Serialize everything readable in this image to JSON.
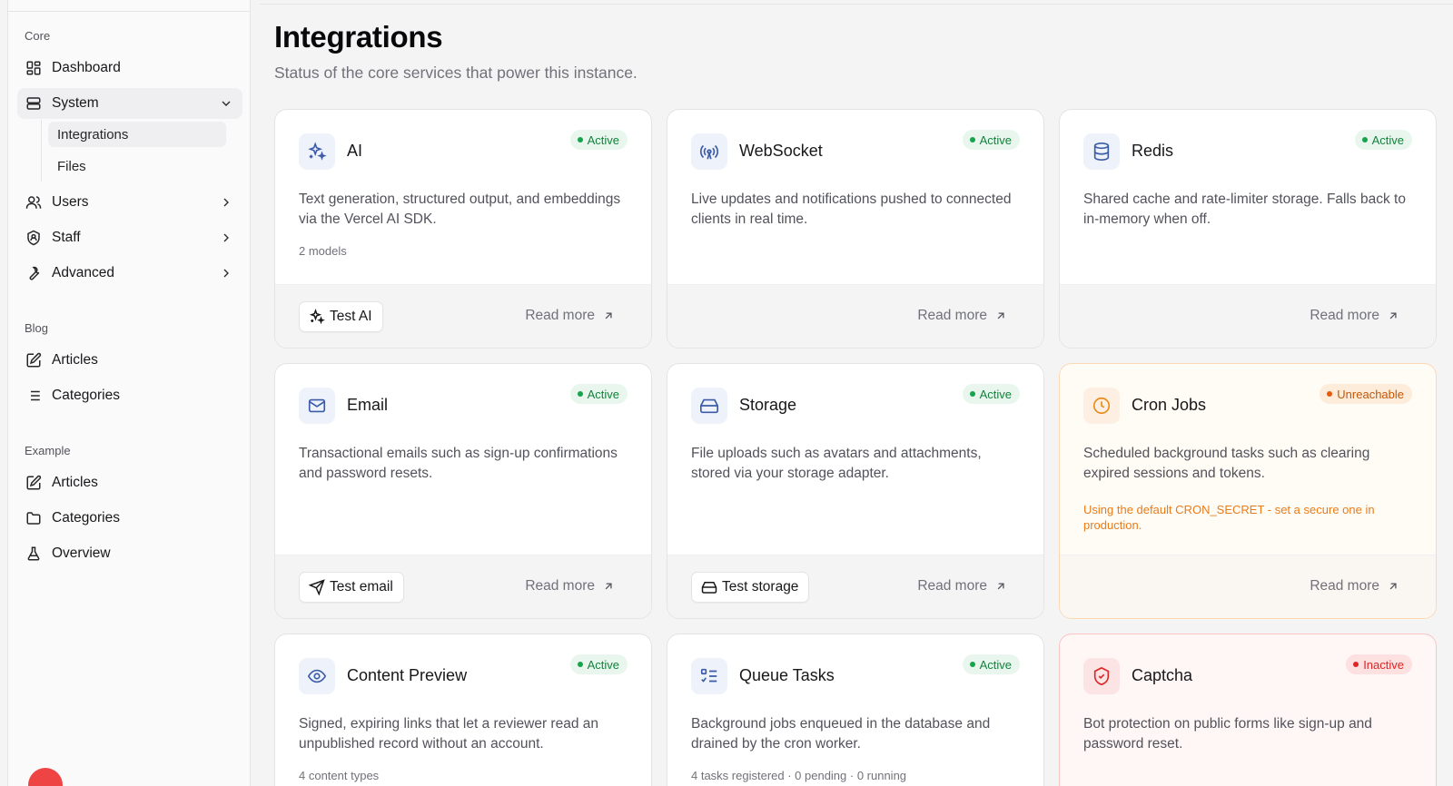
{
  "sidebar": {
    "groups": {
      "core": "Core",
      "blog": "Blog",
      "example": "Example"
    },
    "items": {
      "dashboard": "Dashboard",
      "system": "System",
      "integrations": "Integrations",
      "files": "Files",
      "users": "Users",
      "staff": "Staff",
      "advanced": "Advanced",
      "blog_articles": "Articles",
      "blog_categories": "Categories",
      "example_articles": "Articles",
      "example_categories": "Categories",
      "overview": "Overview"
    }
  },
  "header": {
    "title": "Integrations",
    "subtitle": "Status of the core services that power this instance."
  },
  "cards": {
    "ai": {
      "title": "AI",
      "status": "Active",
      "description": "Text generation, structured output, and embeddings via the Vercel AI SDK.",
      "meta": "2 models",
      "test_label": "Test AI",
      "read_more": "Read more"
    },
    "websocket": {
      "title": "WebSocket",
      "status": "Active",
      "description": "Live updates and notifications pushed to connected clients in real time.",
      "read_more": "Read more"
    },
    "redis": {
      "title": "Redis",
      "status": "Active",
      "description": "Shared cache and rate-limiter storage. Falls back to in-memory when off.",
      "read_more": "Read more"
    },
    "email": {
      "title": "Email",
      "status": "Active",
      "description": "Transactional emails such as sign-up confirmations and password resets.",
      "test_label": "Test email",
      "read_more": "Read more"
    },
    "storage": {
      "title": "Storage",
      "status": "Active",
      "description": "File uploads such as avatars and attachments, stored via your storage adapter.",
      "test_label": "Test storage",
      "read_more": "Read more"
    },
    "cron": {
      "title": "Cron Jobs",
      "status": "Unreachable",
      "description": "Scheduled background tasks such as clearing expired sessions and tokens.",
      "warning": "Using the default CRON_SECRET - set a secure one in production.",
      "read_more": "Read more"
    },
    "content_preview": {
      "title": "Content Preview",
      "status": "Active",
      "description": "Signed, expiring links that let a reviewer read an unpublished record without an account.",
      "meta": "4 content types"
    },
    "queue": {
      "title": "Queue Tasks",
      "status": "Active",
      "description": "Background jobs enqueued in the database and drained by the cron worker.",
      "meta": "4 tasks registered · 0 pending · 0 running"
    },
    "captcha": {
      "title": "Captcha",
      "status": "Inactive",
      "description": "Bot protection on public forms like sign-up and password reset."
    }
  },
  "colors": {
    "active": "#16a34a",
    "unreachable": "#ea580c",
    "inactive": "#dc2626",
    "icon_accent": "#3b5ba9"
  }
}
